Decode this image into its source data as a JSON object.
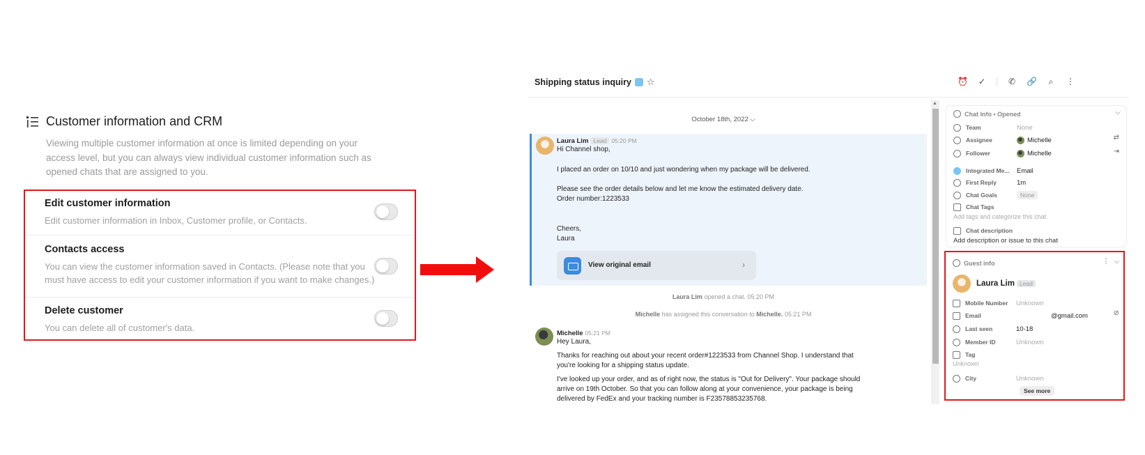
{
  "settings": {
    "section_title": "Customer information and CRM",
    "section_desc": "Viewing multiple customer information at once is limited depending on your access level, but you can always view individual customer information such as opened chats that are assigned to you.",
    "permissions": [
      {
        "title": "Edit customer information",
        "desc": "Edit customer information in Inbox, Customer profile, or Contacts.",
        "enabled": false
      },
      {
        "title": "Contacts access",
        "desc": "You can view the customer information saved in Contacts. (Please note that you must have access to edit your customer information if you want to make changes.)",
        "enabled": false
      },
      {
        "title": "Delete customer",
        "desc": "You can delete all of customer's data.",
        "enabled": false
      }
    ]
  },
  "chat": {
    "title": "Shipping status inquiry",
    "date_separator": "October 18th, 2022",
    "email_message": {
      "sender": "Laura Lim",
      "tag": "Lead",
      "time": "05:20 PM",
      "lines": [
        "Hi Channel shop,",
        "I placed an order on 10/10 and just wondering when my package will be delivered.",
        "Please see the order details below and let me know the estimated delivery date.",
        "Order number:1223533",
        "Cheers,",
        "Laura"
      ],
      "view_button": "View original email"
    },
    "system_1": {
      "actor": "Laura Lim",
      "text": "opened a chat.",
      "time": "05:20 PM"
    },
    "system_2": {
      "actor": "Michelle",
      "text": "has assigned this conversation to",
      "target": "Michelle.",
      "time": "05:21 PM"
    },
    "reply": {
      "sender": "Michelle",
      "time": "05:21 PM",
      "lines": [
        "Hey Laura,",
        "Thanks for reaching out about your recent order#1223533 from Channel Shop. I understand that",
        "you're looking for a shipping status update.",
        "I've looked up your order, and as of right now, the status is \"Out for Delivery\". Your package should",
        "arrive on 19th October. So that you can follow along at your convenience, your package is being",
        "delivered by FedEx and your tracking number is F23578853235768."
      ]
    }
  },
  "chat_info": {
    "header": "Chat Info • Opened",
    "rows": [
      {
        "label": "Team",
        "value": "None",
        "muted": true
      },
      {
        "label": "Assignee",
        "value": "Michelle"
      },
      {
        "label": "Follower",
        "value": "Michelle"
      },
      {
        "label": "Integrated Me...",
        "value": "Email"
      },
      {
        "label": "First Reply",
        "value": "1m"
      },
      {
        "label": "Chat Goals",
        "value": "None"
      },
      {
        "label": "Chat Tags",
        "value": ""
      }
    ],
    "tags_hint": "Add tags and categorize this chat.",
    "desc_label": "Chat description",
    "desc_hint": "Add description or issue to this chat"
  },
  "guest_info": {
    "header": "Guest info",
    "name": "Laura Lim",
    "tag": "Lead",
    "rows": [
      {
        "label": "Mobile Number",
        "value": "Unknown"
      },
      {
        "label": "Email",
        "value": "@gmail.com"
      },
      {
        "label": "Last seen",
        "value": "10-18"
      },
      {
        "label": "Member ID",
        "value": "Unknown"
      },
      {
        "label": "Tag",
        "value": "Unknown"
      },
      {
        "label": "City",
        "value": "Unknown"
      }
    ],
    "see_more": "See more"
  },
  "colors": {
    "highlight_border": "#e3161b",
    "arrow": "#f20d0d",
    "accent": "#3d8bdd"
  },
  "icons": [
    "list-icon",
    "channel-icon",
    "star-icon",
    "alarm-icon",
    "check-icon",
    "phone-icon",
    "link-icon",
    "search-icon",
    "kebab-icon",
    "mail-icon",
    "chevron-right-icon"
  ]
}
